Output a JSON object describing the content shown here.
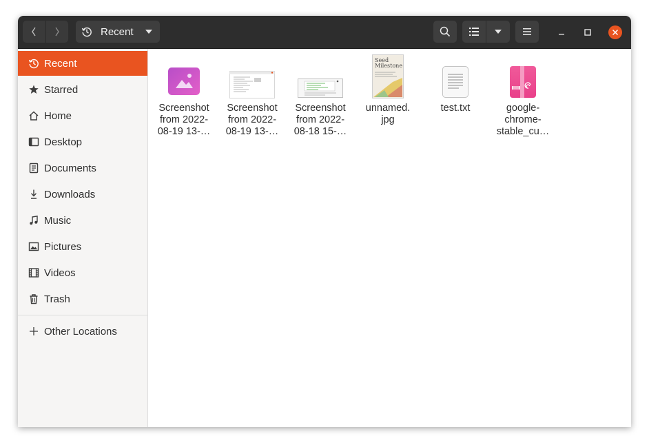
{
  "header": {
    "back_icon": "chevron-left-icon",
    "forward_icon": "chevron-right-icon",
    "path_label": "Recent",
    "path_icon": "history-icon",
    "search_icon": "search-icon",
    "view_icon": "list-view-icon",
    "menu_icon": "hamburger-menu-icon"
  },
  "sidebar": {
    "items": [
      {
        "label": "Recent",
        "icon": "history-icon"
      },
      {
        "label": "Starred",
        "icon": "star-icon"
      },
      {
        "label": "Home",
        "icon": "home-icon"
      },
      {
        "label": "Desktop",
        "icon": "desktop-icon"
      },
      {
        "label": "Documents",
        "icon": "document-icon"
      },
      {
        "label": "Downloads",
        "icon": "download-icon"
      },
      {
        "label": "Music",
        "icon": "music-icon"
      },
      {
        "label": "Pictures",
        "icon": "picture-icon"
      },
      {
        "label": "Videos",
        "icon": "video-icon"
      },
      {
        "label": "Trash",
        "icon": "trash-icon"
      }
    ],
    "other_locations": "Other Locations"
  },
  "files": [
    {
      "line1": "Screenshot",
      "line2": "from 2022-",
      "line3": "08-19 13-…"
    },
    {
      "line1": "Screenshot",
      "line2": "from 2022-",
      "line3": "08-19 13-…"
    },
    {
      "line1": "Screenshot",
      "line2": "from 2022-",
      "line3": "08-18 15-…"
    },
    {
      "line1": "unnamed.",
      "line2": "jpg",
      "line3": ""
    },
    {
      "line1": "test.txt",
      "line2": "",
      "line3": ""
    },
    {
      "line1": "google-",
      "line2": "chrome-",
      "line3": "stable_cu…"
    }
  ],
  "colors": {
    "accent": "#e95420",
    "header_bg": "#2d2d2d",
    "sidebar_bg": "#f6f5f4"
  }
}
